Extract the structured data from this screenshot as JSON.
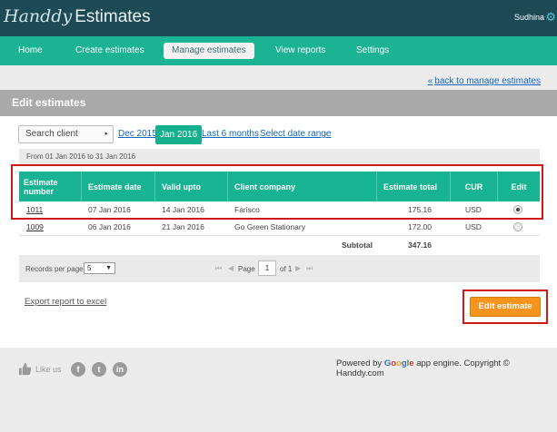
{
  "app": {
    "logo_script": "Handdy",
    "logo_text": "Estimates",
    "user": "Sudhina"
  },
  "nav": {
    "items": [
      "Home",
      "Create estimates",
      "Manage estimates",
      "View reports",
      "Settings"
    ],
    "active": "Manage estimates"
  },
  "back_link": "back to manage estimates",
  "section_title": "Edit estimates",
  "filter": {
    "search_placeholder": "Search client",
    "periods": [
      "Dec 2015",
      "Jan 2016",
      "Last 6 months",
      "Select date range"
    ],
    "active_period": "Jan 2016",
    "range_text": "From 01 Jan 2016 to 31 Jan 2016"
  },
  "table": {
    "headers": [
      "Estimate number",
      "Estimate date",
      "Valid upto",
      "Client company",
      "Estimate total",
      "CUR",
      "Edit"
    ],
    "rows": [
      {
        "number": "1011",
        "date": "07 Jan 2016",
        "valid": "14 Jan 2016",
        "client": "Farisco",
        "total": "175.16",
        "cur": "USD",
        "selected": true
      },
      {
        "number": "1009",
        "date": "06 Jan 2016",
        "valid": "21 Jan 2016",
        "client": "Go Green Stationary",
        "total": "172.00",
        "cur": "USD",
        "selected": false
      }
    ],
    "subtotal_label": "Subtotal",
    "subtotal_value": "347.16"
  },
  "pager": {
    "records_label": "Records per page",
    "records_value": "5",
    "page_label": "Page",
    "page_value": "1",
    "of_label": "of 1"
  },
  "actions": {
    "export": "Export report to excel",
    "edit_button": "Edit estimate"
  },
  "footer": {
    "like_us": "Like us",
    "powered_prefix": "Powered by",
    "google": [
      "G",
      "o",
      "o",
      "g",
      "l",
      "e"
    ],
    "powered_suffix": "app engine. Copyright © Handdy.com"
  },
  "colors": {
    "header": "#1e4a56",
    "nav": "#1bb393",
    "accent": "#17b08f",
    "edit_button": "#f7941d",
    "highlight": "#d01818"
  }
}
